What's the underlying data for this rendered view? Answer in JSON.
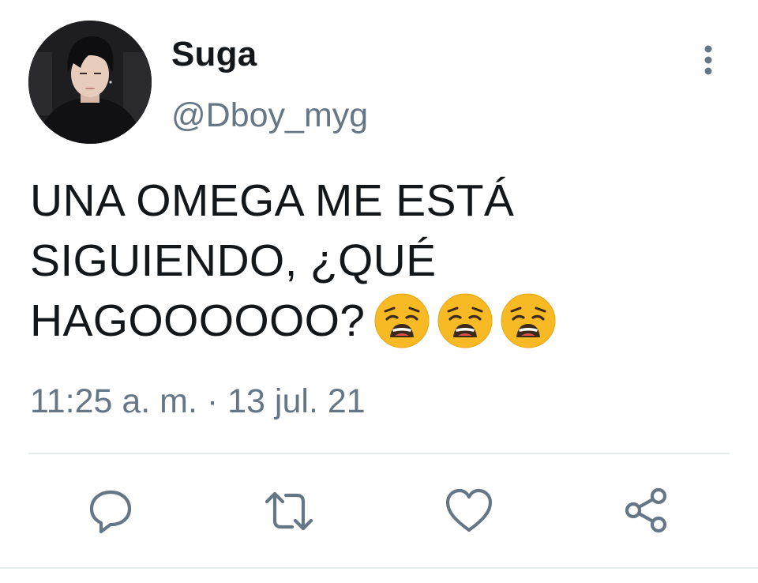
{
  "tweet": {
    "display_name": "Suga",
    "handle": "@Dboy_myg",
    "text_lines": [
      "UNA OMEGA ME ESTÁ",
      "SIGUIENDO, ¿QUÉ",
      "HAGOOOOOO?"
    ],
    "emojis": [
      "weary-face",
      "weary-face",
      "weary-face"
    ],
    "timestamp": "11:25 a. m. · 13 jul. 21"
  },
  "icons": {
    "more": "vertical-ellipsis-icon",
    "reply": "reply-icon",
    "retweet": "retweet-icon",
    "like": "heart-icon",
    "share": "share-icon"
  },
  "colors": {
    "text": "#14171a",
    "secondary": "#657786",
    "divider": "#e6ecf0",
    "emoji": "#f7b924"
  }
}
